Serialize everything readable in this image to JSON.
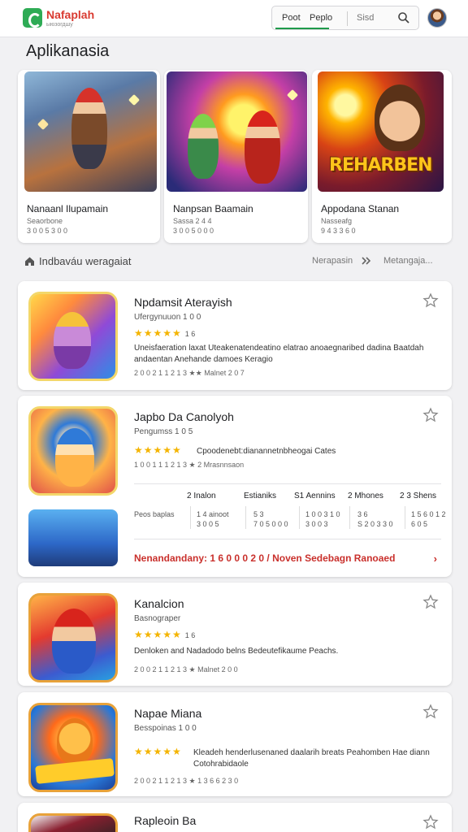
{
  "header": {
    "brand": "Nafaplah",
    "brand_sub": "ыюзогдшу",
    "tab_1": "Poot",
    "tab_2": "Peplo",
    "search_placeholder": "Sisd",
    "search_icon": "search-icon",
    "accent": "#1e9a4a"
  },
  "page_title": "Aplikanasia",
  "featured": [
    {
      "title": "Nanaanl Ilupamain",
      "sub1": "Seaorbone",
      "sub2": "3 0 0 5 3 0 0"
    },
    {
      "title": "Nanpsan Baamain",
      "sub1": "Sassa 2 4 4",
      "sub2": "3 0 0 5 0 0 0"
    },
    {
      "title": "Appodana Stanan",
      "sub1": "Nasseafg",
      "sub2": "9 4 3 3 6 0"
    }
  ],
  "banner_text": "REHARBEN",
  "section": {
    "label": "Indbaváu weragaiat",
    "link_1": "Nerapasin",
    "link_2": "Metangaja..."
  },
  "apps": [
    {
      "name": "Npdamsit Aterayish",
      "meta": "Ufergynuuon  1 0 0",
      "stars": "★★★★★",
      "count": "1 6",
      "desc": "Uneisfaeration laxat Uteakenatendeatino elatrao anoaegnaribed dadina Baatdah andaentan Anehande damoes Keragio",
      "foot": "2 0 0 2 1  1 2 1 3  ★★  Malnet 2 0 7"
    },
    {
      "name": "Japbo Da Canolyoh",
      "meta": "Pengumss  1 0 5",
      "stars": "★★★★★",
      "count": "",
      "desc": "Cpoodenebt:dianannetnbheogai Cates",
      "foot": "1 0 0 1 1  1 2 1 3  ★ 2 Mrasnnsaon"
    },
    {
      "name": "Kanalcion",
      "meta": "Basnograper",
      "stars": "★★★★★",
      "count": "1 6",
      "desc": "Denloken and Nadadodo belns Bedeutefikaume Peachs.",
      "foot": "2 0 0 2 1  1 2 1 3  ★ Malnet 2 0 0"
    },
    {
      "name": "Napae Miana",
      "meta": "Besspoinas  1 0 0",
      "stars": "★★★★★",
      "count": "",
      "desc": "Kleadeh henderlusenaned daalarih breats Peahomben Hae diann Cotohrabidaole",
      "foot": "2 0 0 2 1  1 2 1 3  ★ 1 3 6 6 2 3 0"
    },
    {
      "name": "Rapleoin Ba"
    }
  ],
  "stats": {
    "headers": [
      "2 Inalon",
      "Estianiks",
      "S1 Aennins",
      "2 Mhones",
      "2 3 Shens"
    ],
    "row_label": "Peos baplas",
    "cells": [
      "1 4 ainoot\n3 0 0 5",
      "5 3\n7 0 5 0 0 0",
      "1 0 0 3 1 0\n3 0 0 3",
      "3 6\nS 2 0 3 3 0",
      "1 5 6 0 1 2\n6 0 5"
    ]
  },
  "promo": {
    "text": "Nenandandany: 1 6 0 0  0 2 0 /  Noven  Sedebagn  Ranoaed",
    "arrow": "›"
  },
  "colors": {
    "brand": "#d93a30",
    "accent_green": "#1e9a4a",
    "star": "#f4b400",
    "promo": "#c9302c"
  }
}
